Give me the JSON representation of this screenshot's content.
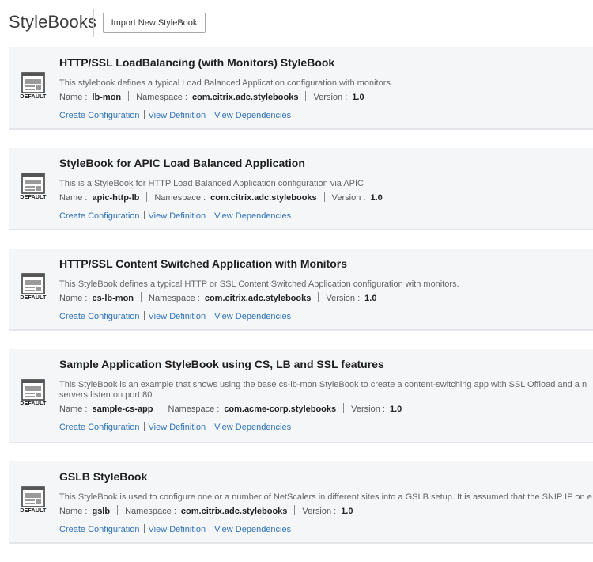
{
  "header": {
    "title": "StyleBooks",
    "import_button_label": "Import New StyleBook"
  },
  "labels": {
    "name": "Name :",
    "namespace": "Namespace :",
    "version": "Version :",
    "default_badge": "DEFAULT",
    "create_configuration": "Create Configuration",
    "view_definition": "View Definition",
    "view_dependencies": "View Dependencies"
  },
  "icons": {
    "stylebook": "document-template-icon"
  },
  "colors": {
    "link": "#2f73b8",
    "card_background": "#f5f6f8"
  },
  "stylebooks": [
    {
      "title": "HTTP/SSL LoadBalancing (with Monitors) StyleBook",
      "description": "This stylebook defines a typical Load Balanced Application configuration with monitors.",
      "name": "lb-mon",
      "namespace": "com.citrix.adc.stylebooks",
      "version": "1.0"
    },
    {
      "title": "StyleBook for APIC Load Balanced Application",
      "description": "This is a StyleBook for HTTP Load Balanced Application configuration via APIC",
      "name": "apic-http-lb",
      "namespace": "com.citrix.adc.stylebooks",
      "version": "1.0"
    },
    {
      "title": "HTTP/SSL Content Switched Application with Monitors",
      "description": "This StyleBook defines a typical HTTP or SSL Content Switched Application configuration with monitors.",
      "name": "cs-lb-mon",
      "namespace": "com.citrix.adc.stylebooks",
      "version": "1.0"
    },
    {
      "title": "Sample Application StyleBook using CS, LB and SSL features",
      "description": "This StyleBook is an example that shows using the base cs-lb-mon StyleBook to create a content-switching app with SSL Offload and a n servers listen on port 80.",
      "name": "sample-cs-app",
      "namespace": "com.acme-corp.stylebooks",
      "version": "1.0"
    },
    {
      "title": "GSLB StyleBook",
      "description": "This StyleBook is used to configure one or a number of NetScalers in different sites into a GSLB setup. It is assumed that the SNIP IP on e",
      "name": "gslb",
      "namespace": "com.citrix.adc.stylebooks",
      "version": "1.0"
    }
  ]
}
